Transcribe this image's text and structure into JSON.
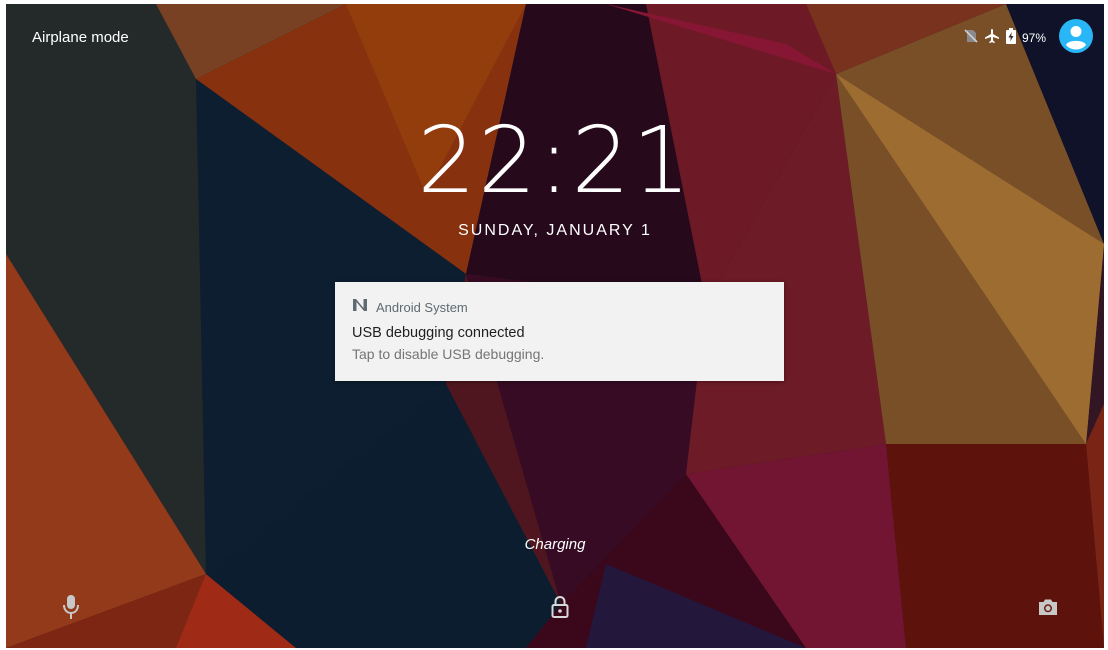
{
  "status_bar": {
    "carrier_text": "Airplane mode",
    "battery_percent": "97%",
    "icons": [
      "no-sim-icon",
      "airplane-icon",
      "battery-charging-icon",
      "user-avatar-icon"
    ],
    "avatar_color": "#29b6f6"
  },
  "lockscreen": {
    "time": "22:21",
    "date": "SUNDAY, JANUARY 1",
    "charging_text": "Charging"
  },
  "notification": {
    "app_name": "Android System",
    "app_icon": "android-n-icon",
    "title": "USB debugging connected",
    "text": "Tap to disable USB debugging."
  },
  "bottom_actions": {
    "left": "microphone-icon",
    "center": "lock-icon",
    "right": "camera-icon"
  }
}
